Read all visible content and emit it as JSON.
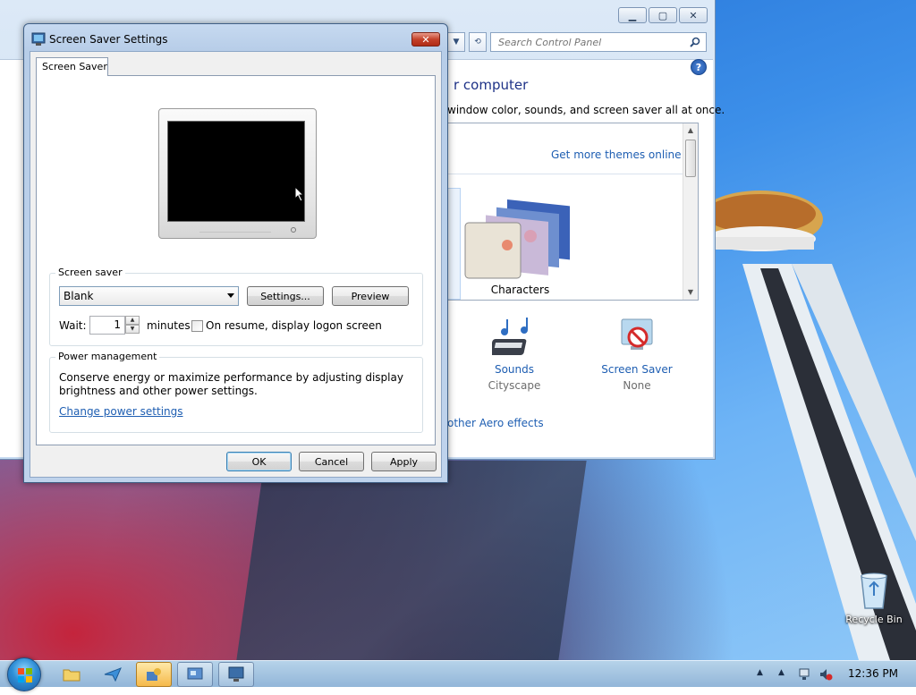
{
  "control_panel": {
    "search_placeholder": "Search Control Panel",
    "heading": "r computer",
    "subtitle": "window color, sounds, and screen saver all at once.",
    "themes_link": "Get more themes online",
    "theme_characters": "Characters",
    "sounds": {
      "title": "Sounds",
      "value": "Cityscape"
    },
    "screen_saver": {
      "title": "Screen Saver",
      "value": "None"
    },
    "aero_link": "other Aero effects",
    "help": "?"
  },
  "dialog": {
    "title": "Screen Saver Settings",
    "tab": "Screen Saver",
    "screen_saver_group": "Screen saver",
    "selected_saver": "Blank",
    "settings_button": "Settings...",
    "preview_button": "Preview",
    "wait_label": "Wait:",
    "wait_value": "1",
    "minutes_label": "minutes",
    "resume_label": "On resume, display logon screen",
    "power_group": "Power management",
    "power_text_1": "Conserve energy or maximize performance by adjusting display",
    "power_text_2": "brightness and other power settings.",
    "power_link": "Change power settings",
    "ok": "OK",
    "cancel": "Cancel",
    "apply": "Apply"
  },
  "desktop": {
    "recycle_bin": "Recycle Bin"
  },
  "taskbar": {
    "clock": "12:36 PM"
  }
}
